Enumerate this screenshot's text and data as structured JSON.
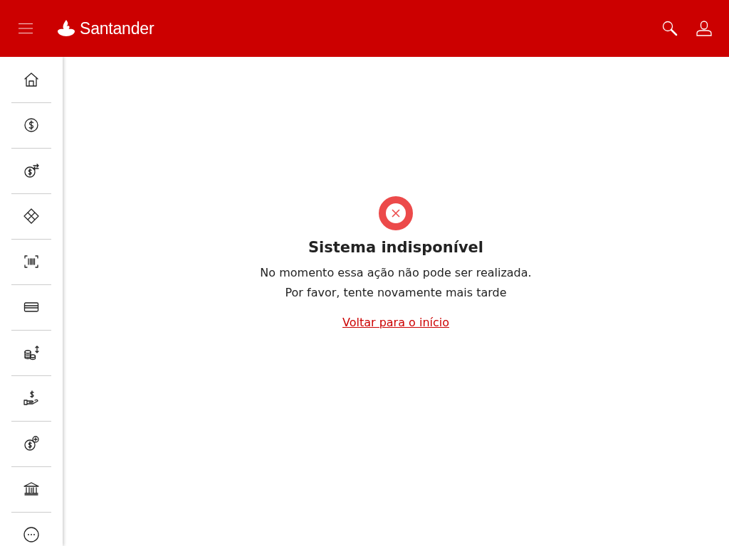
{
  "header": {
    "brand": "Santander"
  },
  "sidebar": {
    "items": [
      {
        "kind": "home"
      },
      {
        "kind": "dollar"
      },
      {
        "kind": "transfer"
      },
      {
        "kind": "pix"
      },
      {
        "kind": "barcode"
      },
      {
        "kind": "card"
      },
      {
        "kind": "coins"
      },
      {
        "kind": "hand"
      },
      {
        "kind": "dollar-plus"
      },
      {
        "kind": "bank"
      },
      {
        "kind": "more"
      }
    ]
  },
  "message": {
    "title": "Sistema indisponível",
    "text": "No momento essa ação não pode ser realizada. Por favor, tente novamente mais tarde",
    "link": "Voltar para o início"
  }
}
